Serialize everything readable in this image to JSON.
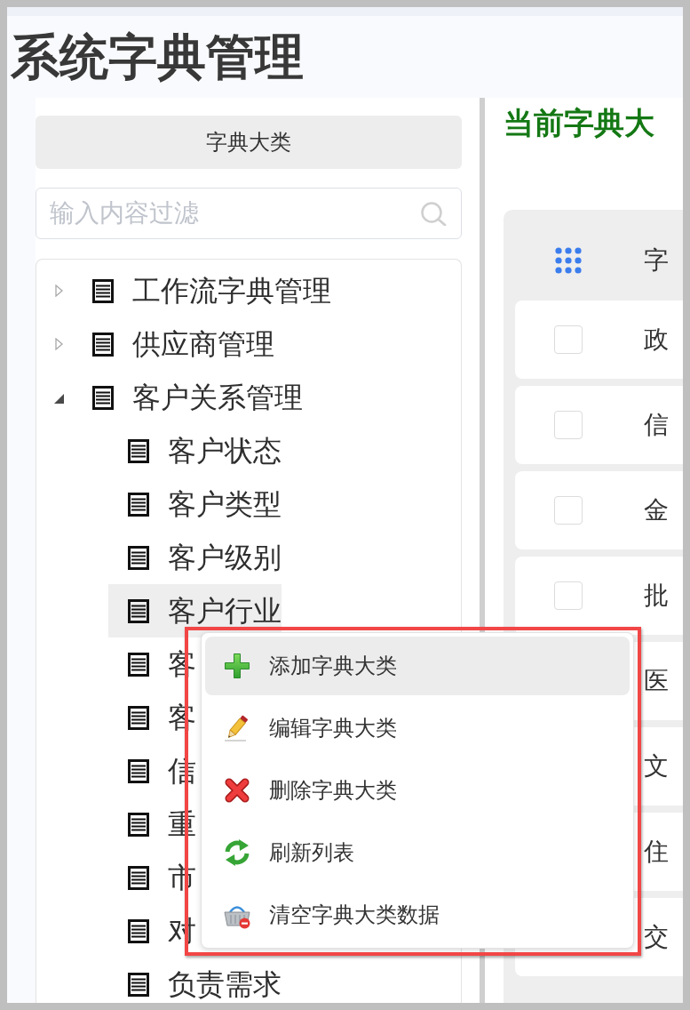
{
  "page_title": "系统字典管理",
  "sidebar": {
    "category_button": "字典大类",
    "filter": {
      "placeholder": "输入内容过滤"
    },
    "tree": [
      {
        "label": "工作流字典管理",
        "expanded": false,
        "selected": false
      },
      {
        "label": "供应商管理",
        "expanded": false,
        "selected": false
      },
      {
        "label": "客户关系管理",
        "expanded": true,
        "selected": false,
        "children": [
          {
            "label": "客户状态",
            "selected": false
          },
          {
            "label": "客户类型",
            "selected": false
          },
          {
            "label": "客户级别",
            "selected": false
          },
          {
            "label": "客户行业",
            "selected": true
          },
          {
            "label": "客",
            "selected": false
          },
          {
            "label": "客",
            "selected": false
          },
          {
            "label": "信",
            "selected": false
          },
          {
            "label": "重",
            "selected": false
          },
          {
            "label": "市",
            "selected": false
          },
          {
            "label": "对",
            "selected": false
          },
          {
            "label": "负责需求",
            "selected": false
          }
        ]
      }
    ]
  },
  "content": {
    "title": "当前字典大",
    "table": {
      "columns": [
        {
          "label": "字"
        }
      ],
      "rows": [
        {
          "checked": false,
          "cells": [
            "政"
          ]
        },
        {
          "checked": false,
          "cells": [
            "信"
          ]
        },
        {
          "checked": false,
          "cells": [
            "金"
          ]
        },
        {
          "checked": false,
          "cells": [
            "批"
          ]
        },
        {
          "cells": [
            "医"
          ]
        },
        {
          "cells": [
            "文"
          ]
        },
        {
          "cells": [
            "住"
          ]
        },
        {
          "cells": [
            "交"
          ]
        }
      ]
    }
  },
  "context_menu": {
    "items": [
      {
        "kind": "add",
        "label": "添加字典大类",
        "highlighted": true
      },
      {
        "kind": "edit",
        "label": "编辑字典大类",
        "highlighted": false
      },
      {
        "kind": "delete",
        "label": "删除字典大类",
        "highlighted": false
      },
      {
        "kind": "refresh",
        "label": "刷新列表",
        "highlighted": false
      },
      {
        "kind": "clear",
        "label": "清空字典大类数据",
        "highlighted": false
      }
    ]
  }
}
